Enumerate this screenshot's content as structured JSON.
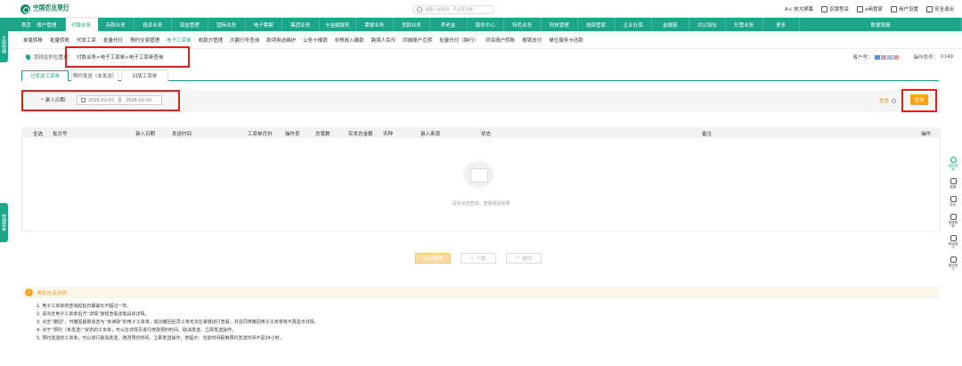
{
  "topbar": {
    "logo_cn": "中国农业银行",
    "logo_en": "AGRICULTURAL BANK OF CHINA",
    "search_placeholder": "请输入关键词、产品及功能",
    "links": [
      "A+ 放大屏幕",
      "农银悉享",
      "e商管家",
      "用户设置",
      "安全退出"
    ]
  },
  "nav": [
    "首页",
    "账户管理",
    "付款业务",
    "存款业务",
    "投资业务",
    "现金管理",
    "国际业务",
    "电子票据",
    "集团业务",
    "卡金融服务",
    "票据业务",
    "贷款业务",
    "养老金",
    "服务中心",
    "特色业务",
    "科技管理",
    "融资管家",
    "企业社保",
    "金融链",
    "对公钱包",
    "托管业务",
    "更多",
    "数据填报"
  ],
  "nav_active_index": 2,
  "subnav": [
    "单笔转账",
    "批量转账",
    "代发工资",
    "批量代付",
    "预约交易管理",
    "电子工资单",
    "收款方管理",
    "大额行号查询",
    "款项用途维护",
    "公务卡报销",
    "非税收入缴款",
    "跨境人民币",
    "同城账户互转",
    "批量代付（跨行）",
    "同名账户转账",
    "报销支付",
    "单位服务卡还款"
  ],
  "subnav_active_index": 5,
  "breadcrumb": {
    "label": "您现在的位置是：",
    "path": "付款业务>电子工资单>电子工资单查询"
  },
  "account": {
    "customer_label": "客户号：",
    "operator_label": "操作员号：",
    "operator_value": "0149"
  },
  "tabs": [
    "已发送工资单",
    "预约发送（未发送）",
    "旧版工资单"
  ],
  "filter": {
    "label": "录入日期:",
    "start": "2026-02-03",
    "sep": "至",
    "end": "2026-02-03",
    "reset": "重置",
    "query": "查询"
  },
  "table": {
    "headers": [
      "全选",
      "批次号",
      "录入日期",
      "发送时间",
      "工资单月份",
      "操作员",
      "总笔数",
      "实发总金额",
      "币种",
      "录入来源",
      "状态",
      "备注",
      "操作"
    ],
    "empty_text": "请先点击查询，查看相关结果"
  },
  "actions": [
    "打印报表",
    "下载",
    "撤回"
  ],
  "help": {
    "title": "帮助信息说明",
    "items": [
      "1. 电子工资单的查询起始日期最长不超过一年。",
      "2. 请点击电子工资单后方“详情”按钮查看该笔具体详情。",
      "3. 点击“撤回”，可撤回最新状态为“未读取”的电子工资单，成功撤回后员工将无法在掌银进行查看，并且同类撤回电子工资单将不再显示详情。",
      "4. 对于“预约（未发送）”状态的工资单，可以在详情页进行修改预约时间、取消发送、立即发送操作。",
      "5. 预约发送的工资单，可以进行取消发送、修改预约时间、立即发送操作，若提示：当前时间距离预约发送时间不足24小时。"
    ]
  },
  "left_tabs": [
    "大额快捷",
    "快捷菜单"
  ],
  "right_tools": [
    "返回顶部",
    "客服",
    "意见",
    "视频帮助",
    "新版银行",
    "微信银行"
  ],
  "colors": {
    "brand": "#1da58a",
    "accent": "#f8a318",
    "highlight": "#e02020"
  }
}
